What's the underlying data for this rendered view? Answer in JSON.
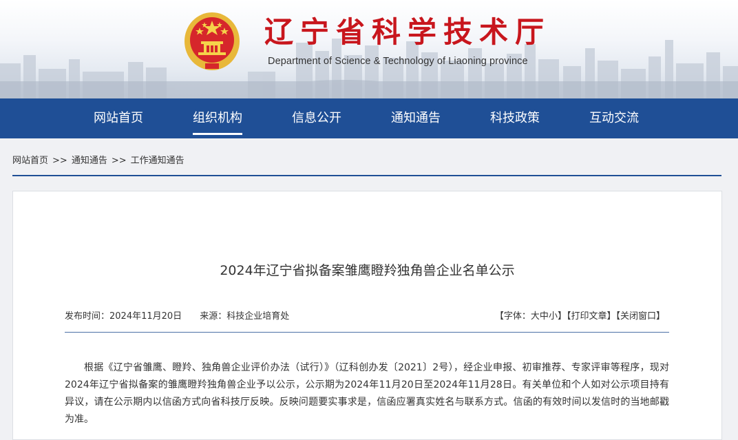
{
  "header": {
    "title": "辽宁省科学技术厅",
    "subtitle": "Department of Science & Technology of Liaoning province"
  },
  "nav": {
    "items": [
      {
        "label": "网站首页"
      },
      {
        "label": "组织机构",
        "active": true
      },
      {
        "label": "信息公开"
      },
      {
        "label": "通知通告"
      },
      {
        "label": "科技政策"
      },
      {
        "label": "互动交流"
      }
    ]
  },
  "breadcrumb": {
    "home": "网站首页",
    "separator": ">>",
    "level1": "通知通告",
    "level2": "工作通知通告"
  },
  "article": {
    "title": "2024年辽宁省拟备案雏鹰瞪羚独角兽企业名单公示",
    "publish_label": "发布时间：",
    "publish_date": "2024年11月20日",
    "source_label": "来源：",
    "source": "科技企业培育处",
    "font_label": "【字体：",
    "font_large": "大",
    "font_medium": "中",
    "font_small": "小",
    "font_close": "】",
    "print_label": "【打印文章】",
    "close_label": "【关闭窗口】",
    "body": "根据《辽宁省雏鹰、瞪羚、独角兽企业评价办法（试行）》（辽科创办发〔2021〕2号），经企业申报、初审推荐、专家评审等程序，现对2024年辽宁省拟备案的雏鹰瞪羚独角兽企业予以公示，公示期为2024年11月20日至2024年11月28日。有关单位和个人如对公示项目持有异议，请在公示期内以信函方式向省科技厅反映。反映问题要实事求是，信函应署真实姓名与联系方式。信函的有效时间以发信时的当地邮戳为准。"
  },
  "colors": {
    "brand_red": "#c8161d",
    "nav_blue": "#1f4f96",
    "page_bg": "#f0f1f4"
  },
  "icons": {
    "emblem": "national-emblem-icon"
  }
}
